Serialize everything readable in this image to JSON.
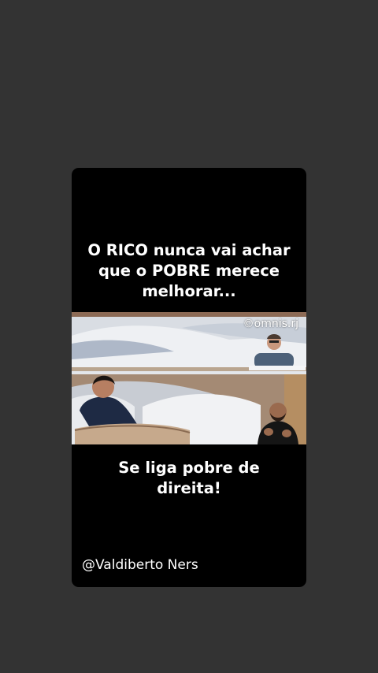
{
  "post": {
    "caption_top": [
      "O RICO nunca vai achar",
      "que o POBRE merece",
      "melhorar..."
    ],
    "caption_bottom": [
      "Se liga pobre de",
      "direita!"
    ],
    "author_handle": "@Valdiberto Ners"
  },
  "video": {
    "watermark": "©omnis.rj"
  },
  "colors": {
    "page_background": "#333333",
    "card_background": "#000000",
    "text": "#ffffff"
  }
}
